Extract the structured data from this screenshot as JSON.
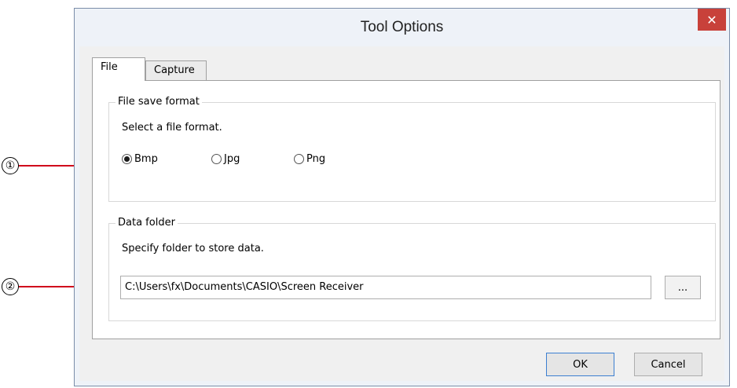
{
  "callouts": [
    "①",
    "②"
  ],
  "window": {
    "title": "Tool Options",
    "close_glyph": "✕"
  },
  "tabs": [
    {
      "label": "File"
    },
    {
      "label": "Capture"
    }
  ],
  "file_save_format": {
    "group_label": "File save format",
    "prompt": "Select a file format.",
    "options": [
      {
        "label": "Bmp",
        "selected": true
      },
      {
        "label": "Jpg",
        "selected": false
      },
      {
        "label": "Png",
        "selected": false
      }
    ]
  },
  "data_folder": {
    "group_label": "Data folder",
    "prompt": "Specify folder to store data.",
    "path_value": "C:\\Users\\fx\\Documents\\CASIO\\Screen Receiver",
    "browse_label": "..."
  },
  "buttons": {
    "ok": "OK",
    "cancel": "Cancel"
  },
  "colors": {
    "callout_line": "#d0021b",
    "close_button": "#c8413a",
    "default_button_border": "#3c7fd1"
  }
}
